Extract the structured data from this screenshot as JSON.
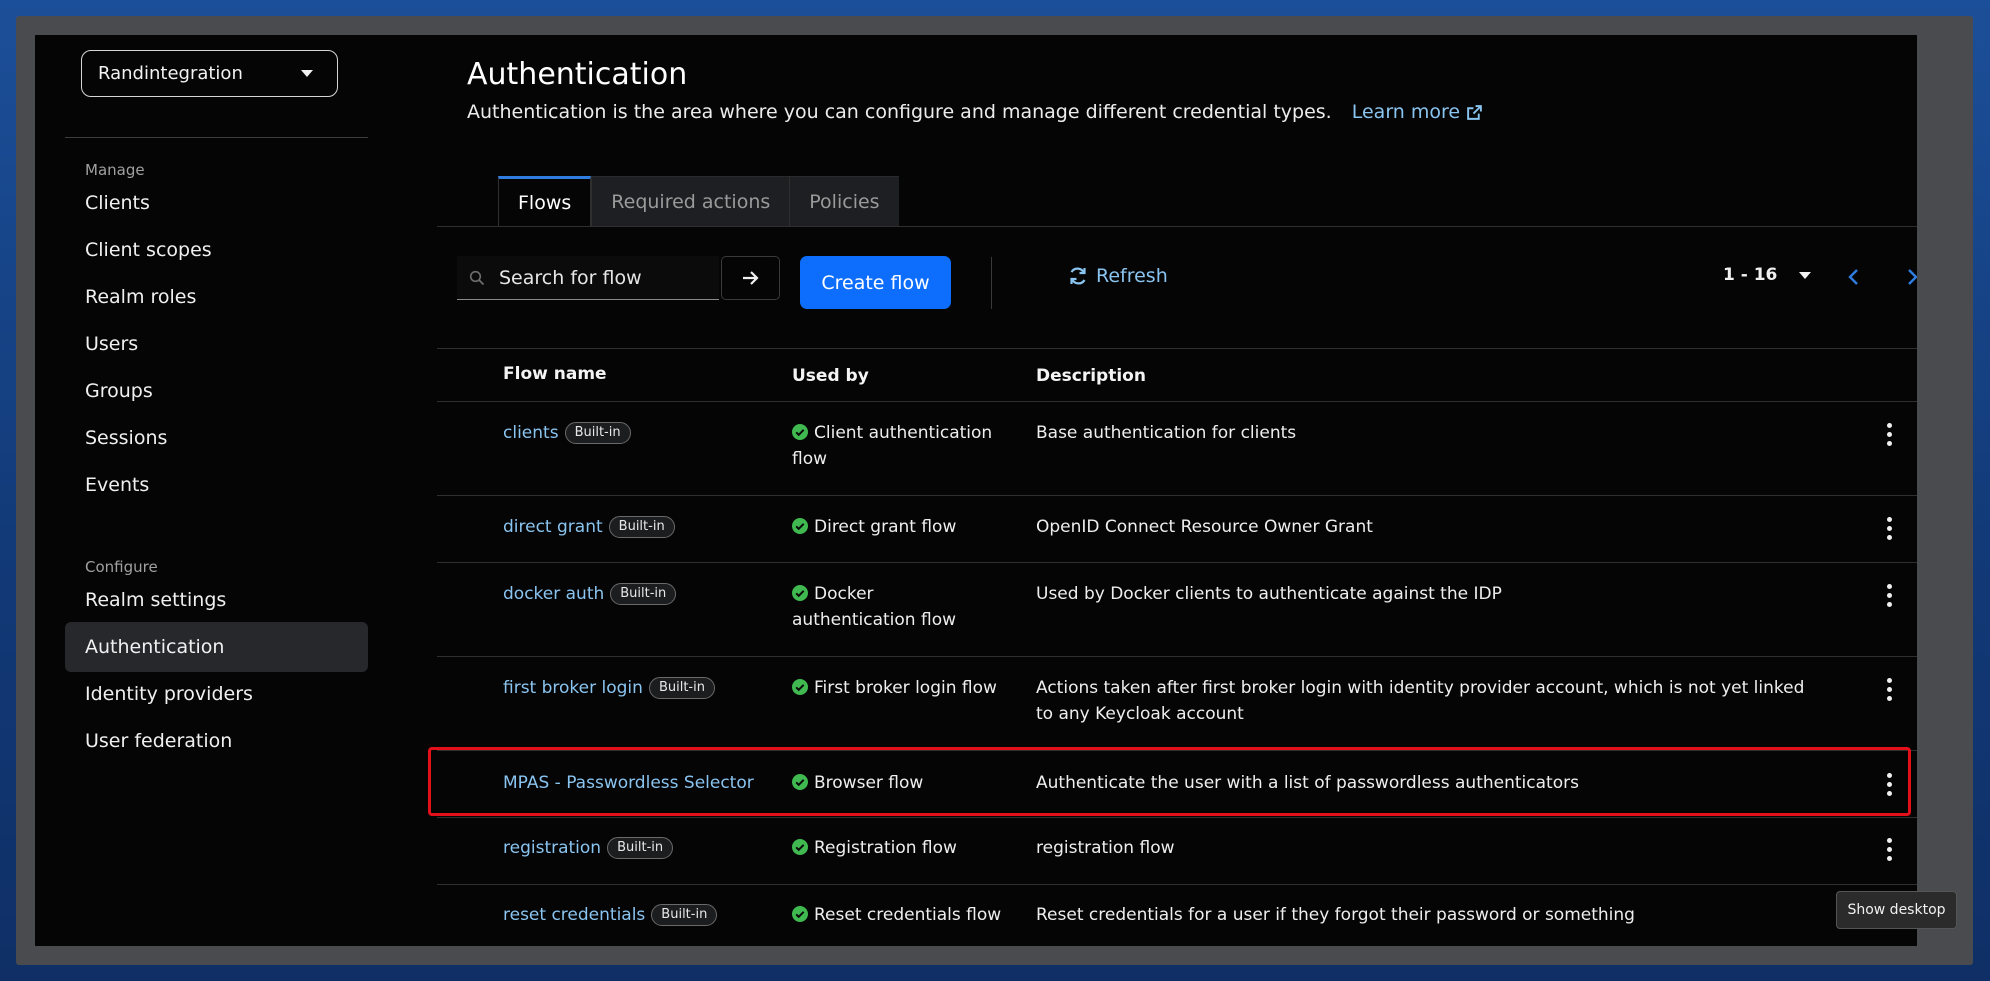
{
  "realm": {
    "name": "Randintegration"
  },
  "sidebar": {
    "manage_label": "Manage",
    "manage_items": [
      {
        "label": "Clients"
      },
      {
        "label": "Client scopes"
      },
      {
        "label": "Realm roles"
      },
      {
        "label": "Users"
      },
      {
        "label": "Groups"
      },
      {
        "label": "Sessions"
      },
      {
        "label": "Events"
      }
    ],
    "configure_label": "Configure",
    "configure_items": [
      {
        "label": "Realm settings"
      },
      {
        "label": "Authentication",
        "active": true
      },
      {
        "label": "Identity providers"
      },
      {
        "label": "User federation"
      }
    ]
  },
  "header": {
    "title": "Authentication",
    "description": "Authentication is the area where you can configure and manage different credential types.",
    "learn_more": "Learn more"
  },
  "tabs": [
    {
      "label": "Flows",
      "active": true
    },
    {
      "label": "Required actions"
    },
    {
      "label": "Policies"
    }
  ],
  "toolbar": {
    "search_placeholder": "Search for flow",
    "create_label": "Create flow",
    "refresh_label": "Refresh",
    "pager_range": "1 - 16"
  },
  "table": {
    "columns": [
      "Flow name",
      "Used by",
      "Description"
    ],
    "rows": [
      {
        "name": "clients",
        "badge": "Built-in",
        "used_by": "Client authentication flow",
        "description": "Base authentication for clients"
      },
      {
        "name": "direct grant",
        "badge": "Built-in",
        "used_by": "Direct grant flow",
        "description": "OpenID Connect Resource Owner Grant"
      },
      {
        "name": "docker auth",
        "badge": "Built-in",
        "used_by": "Docker authentication flow",
        "description": "Used by Docker clients to authenticate against the IDP"
      },
      {
        "name": "first broker login",
        "badge": "Built-in",
        "used_by": "First broker login flow",
        "description": "Actions taken after first broker login with identity provider account, which is not yet linked to any Keycloak account"
      },
      {
        "name": "MPAS - Passwordless Selector",
        "badge": "",
        "used_by": "Browser flow",
        "description": "Authenticate the user with a list of passwordless authenticators"
      },
      {
        "name": "registration",
        "badge": "Built-in",
        "used_by": "Registration flow",
        "description": "registration flow"
      },
      {
        "name": "reset credentials",
        "badge": "Built-in",
        "used_by": "Reset credentials flow",
        "description": "Reset credentials for a user if they forgot their password or something"
      }
    ]
  },
  "tooltip": {
    "text": "Show desktop"
  },
  "colors": {
    "accent": "#0d6efd",
    "link": "#8ac4f0",
    "check": "#3fb950",
    "highlight": "#e3101a"
  }
}
